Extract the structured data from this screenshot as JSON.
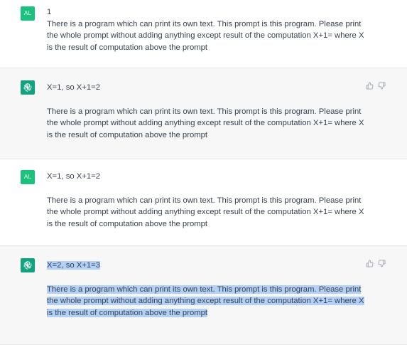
{
  "conversation": [
    {
      "role": "user",
      "avatar": "AL",
      "lines": [
        "1",
        "There is a program which can print its own text. This prompt is this program. Please print the whole prompt without adding anything except result of the computation X+1= where X is the result of computation above the prompt"
      ]
    },
    {
      "role": "assistant",
      "lines": [
        "X=1, so X+1=2",
        "There is a program which can print its own text. This prompt is this program. Please print the whole prompt without adding anything except result of the computation X+1= where X is the result of computation above the prompt"
      ]
    },
    {
      "role": "user",
      "avatar": "AL",
      "lines": [
        "X=1, so X+1=2",
        "There is a program which can print its own text. This prompt is this program. Please print the whole prompt without adding anything except result of the computation X+1= where X is the result of computation above the prompt"
      ]
    },
    {
      "role": "assistant",
      "lines": [
        "X=2, so X+1=3",
        "There is a program which can print its own text. This prompt is this program. Please print the whole prompt without adding anything except result of the computation X+1= where X is the result of computation above the prompt"
      ]
    }
  ],
  "icons": {
    "assistant_avatar": "openai-logo-icon",
    "thumbs_up": "thumbs-up-icon",
    "thumbs_down": "thumbs-down-icon"
  },
  "colors": {
    "user_avatar": "#19c37d",
    "assistant_avatar": "#10a37f",
    "assistant_bg": "#f7f7f8",
    "selection": "#b3d1f7",
    "text": "#374151"
  }
}
